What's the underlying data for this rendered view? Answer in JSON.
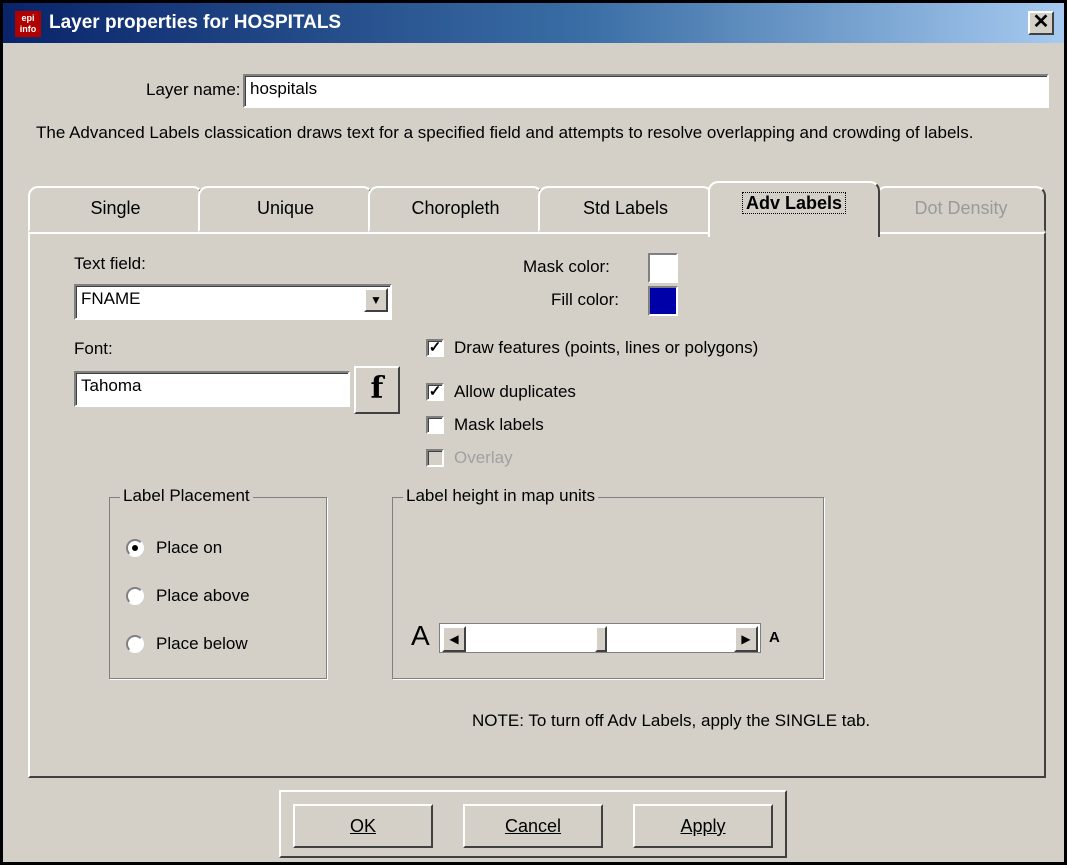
{
  "window": {
    "title": "Layer properties for HOSPITALS",
    "app_icon_text": "epi info",
    "close_glyph": "✕"
  },
  "layer_name": {
    "label": "Layer name:",
    "value": "hospitals"
  },
  "description": "The Advanced Labels classication draws text for a specified field and attempts to resolve overlapping and crowding of labels.",
  "tabs": [
    {
      "label": "Single",
      "state": "normal"
    },
    {
      "label": "Unique",
      "state": "normal"
    },
    {
      "label": "Choropleth",
      "state": "normal"
    },
    {
      "label": "Std Labels",
      "state": "normal"
    },
    {
      "label": "Adv Labels",
      "state": "active"
    },
    {
      "label": "Dot Density",
      "state": "disabled"
    }
  ],
  "panel": {
    "text_field": {
      "label": "Text field:",
      "value": "FNAME",
      "arrow": "▼"
    },
    "font": {
      "label": "Font:",
      "value": "Tahoma",
      "button_glyph": "f"
    },
    "mask_color": {
      "label": "Mask color:",
      "color": "#ffffff"
    },
    "fill_color": {
      "label": "Fill color:",
      "color": "#0000a8"
    },
    "checkboxes": [
      {
        "label": "Draw features (points, lines or polygons)",
        "checked": true,
        "mark": "✓",
        "enabled": true
      },
      {
        "label": "Allow duplicates",
        "checked": true,
        "mark": "✓",
        "enabled": true
      },
      {
        "label": "Mask labels",
        "checked": false,
        "mark": "",
        "enabled": true
      },
      {
        "label": "Overlay",
        "checked": false,
        "mark": "",
        "enabled": false
      }
    ],
    "label_placement": {
      "title": "Label Placement",
      "options": [
        {
          "label": "Place on",
          "selected": true
        },
        {
          "label": "Place above",
          "selected": false
        },
        {
          "label": "Place below",
          "selected": false
        }
      ]
    },
    "label_height": {
      "title": "Label height in map units",
      "min_glyph": "A",
      "max_glyph": "A",
      "left_arrow": "◀",
      "right_arrow": "▶",
      "level_fraction": 0.5
    },
    "note": "NOTE: To turn off Adv Labels, apply the SINGLE tab."
  },
  "buttons": {
    "ok": "OK",
    "cancel": "Cancel",
    "apply": "Apply"
  }
}
